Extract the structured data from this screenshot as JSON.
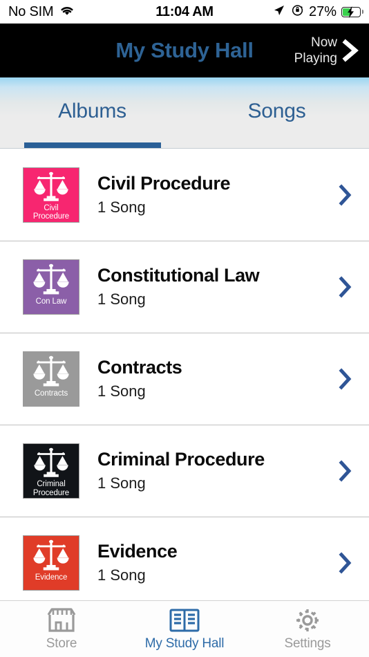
{
  "status_bar": {
    "carrier": "No SIM",
    "wifi_icon": "wifi-icon",
    "time": "11:04 AM",
    "location_icon": "location-arrow-icon",
    "rotation_lock_icon": "rotation-lock-icon",
    "battery_percent": "27%",
    "battery_icon": "battery-charging-icon"
  },
  "navbar": {
    "title": "My Study Hall",
    "title_color": "#2e6395",
    "background": "#000000",
    "now_playing_line1": "Now",
    "now_playing_line2": "Playing",
    "now_playing_chevron_icon": "chevron-right-icon"
  },
  "segmented_tabs": {
    "active_index": 0,
    "accent_color": "#2a5f96",
    "items": [
      {
        "label": "Albums",
        "active": true
      },
      {
        "label": "Songs",
        "active": false
      }
    ]
  },
  "album_list": {
    "chevron_icon": "chevron-right-icon",
    "chevron_color": "#2f5596",
    "rows": [
      {
        "title": "Civil Procedure",
        "subtitle": "1 Song",
        "art_label": "Civil\nProcedure",
        "art_label_line1": "Civil",
        "art_label_line2": "Procedure",
        "art_color": "#f72670",
        "art_icon": "scales-of-justice-icon"
      },
      {
        "title": "Constitutional Law",
        "subtitle": "1 Song",
        "art_label_line1": "Con Law",
        "art_label_line2": "",
        "art_color": "#8b5fa8",
        "art_icon": "scales-of-justice-icon"
      },
      {
        "title": "Contracts",
        "subtitle": "1 Song",
        "art_label_line1": "Contracts",
        "art_label_line2": "",
        "art_color": "#9a9a9a",
        "art_icon": "scales-of-justice-icon"
      },
      {
        "title": "Criminal Procedure",
        "subtitle": "1 Song",
        "art_label_line1": "Criminal",
        "art_label_line2": "Procedure",
        "art_color": "#111418",
        "art_icon": "scales-of-justice-icon"
      },
      {
        "title": "Evidence",
        "subtitle": "1 Song",
        "art_label_line1": "Evidence",
        "art_label_line2": "",
        "art_color": "#e03c28",
        "art_icon": "scales-of-justice-icon"
      }
    ]
  },
  "bottom_bar": {
    "active_index": 1,
    "active_color": "#2d6ba8",
    "inactive_color": "#9a9a9a",
    "items": [
      {
        "label": "Store",
        "icon": "store-icon",
        "active": false
      },
      {
        "label": "My Study Hall",
        "icon": "open-book-icon",
        "active": true
      },
      {
        "label": "Settings",
        "icon": "gear-icon",
        "active": false
      }
    ]
  }
}
